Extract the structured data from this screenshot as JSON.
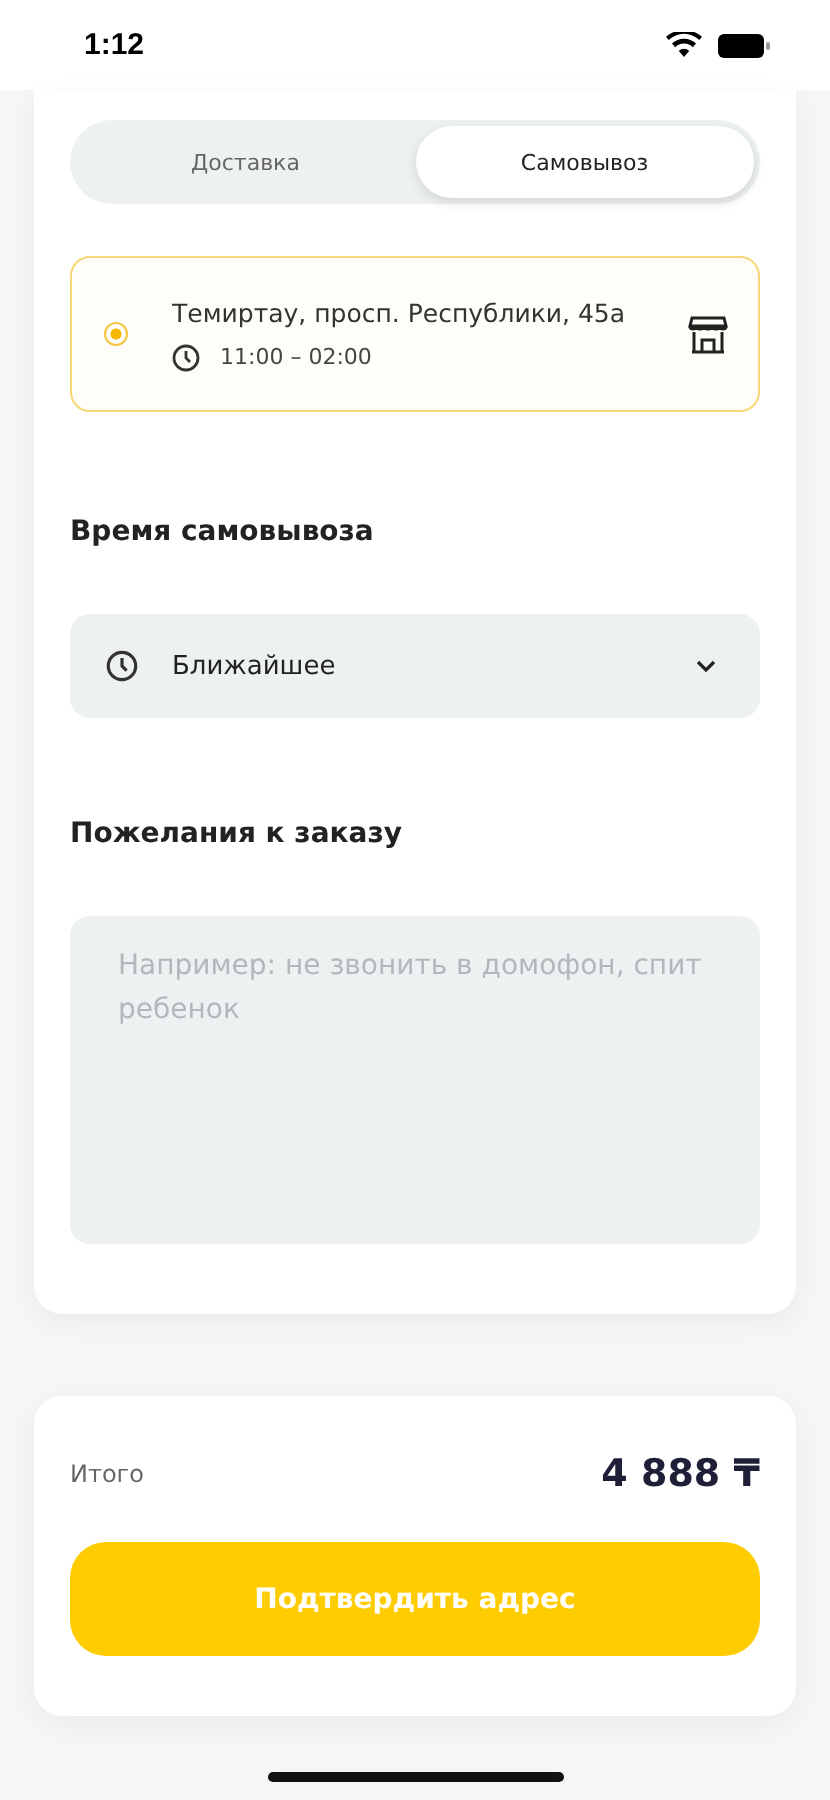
{
  "status_bar": {
    "time": "1:12"
  },
  "tabs": [
    {
      "label": "Доставка",
      "selected": false
    },
    {
      "label": "Самовывоз",
      "selected": true
    }
  ],
  "pickup_points": [
    {
      "address": "Темиртау, просп. Республики, 45а",
      "hours": "11:00 – 02:00",
      "selected": true
    }
  ],
  "pickup_time": {
    "label": "Время самовывоза",
    "value": "Ближайшее"
  },
  "comment": {
    "label": "Пожелания к заказу",
    "placeholder": "Например: не звонить в домофон, спит ребенок"
  },
  "total": {
    "label": "Итого",
    "value": "4 888 ₸"
  },
  "confirm_button": "Подтвердить адрес"
}
